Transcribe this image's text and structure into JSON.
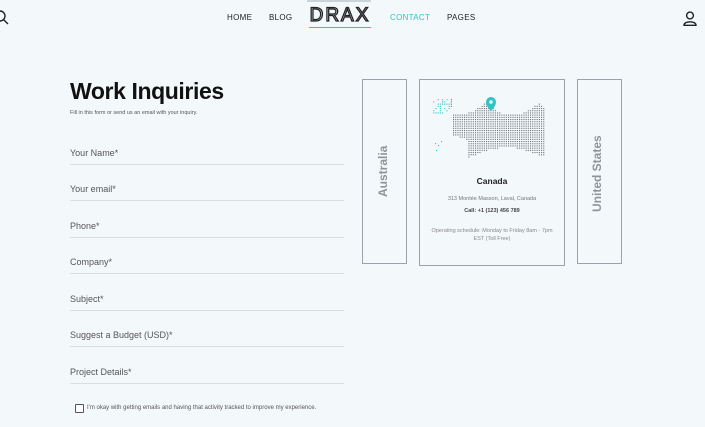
{
  "header": {
    "logo_text": "DRAX",
    "nav": [
      {
        "label": "HOME"
      },
      {
        "label": "BLOG"
      },
      {
        "label": "CONTACT",
        "active": true
      },
      {
        "label": "PAGES"
      }
    ],
    "icons": {
      "search": "search-icon",
      "user": "user-icon"
    },
    "accent_color": "#2cc4c6"
  },
  "form": {
    "title": "Work Inquiries",
    "subtitle": "Fill in this form or send us an email with your inquiry.",
    "fields": [
      {
        "placeholder": "Your Name*",
        "value": ""
      },
      {
        "placeholder": "Your email*",
        "value": ""
      },
      {
        "placeholder": "Phone*",
        "value": ""
      },
      {
        "placeholder": "Company*",
        "value": ""
      },
      {
        "placeholder": "Subject*",
        "value": ""
      },
      {
        "placeholder": "Suggest a Budget (USD)*",
        "value": ""
      },
      {
        "placeholder": "Project Details*",
        "value": ""
      }
    ],
    "consent": {
      "checked": false,
      "label": "I'm okay with getting emails and having that activity tracked to improve my experience."
    }
  },
  "offices": {
    "left_tab": "Australia",
    "right_tab": "United States",
    "active": {
      "country": "Canada",
      "address": "313 Montée Masson, Laval, Canada",
      "call": "Call: +1 (123) 456 789",
      "schedule": "Operating schedule: Monday to Friday 8am - 7pm EST (Toll Free)",
      "pin_icon": "map-pin-icon"
    }
  }
}
